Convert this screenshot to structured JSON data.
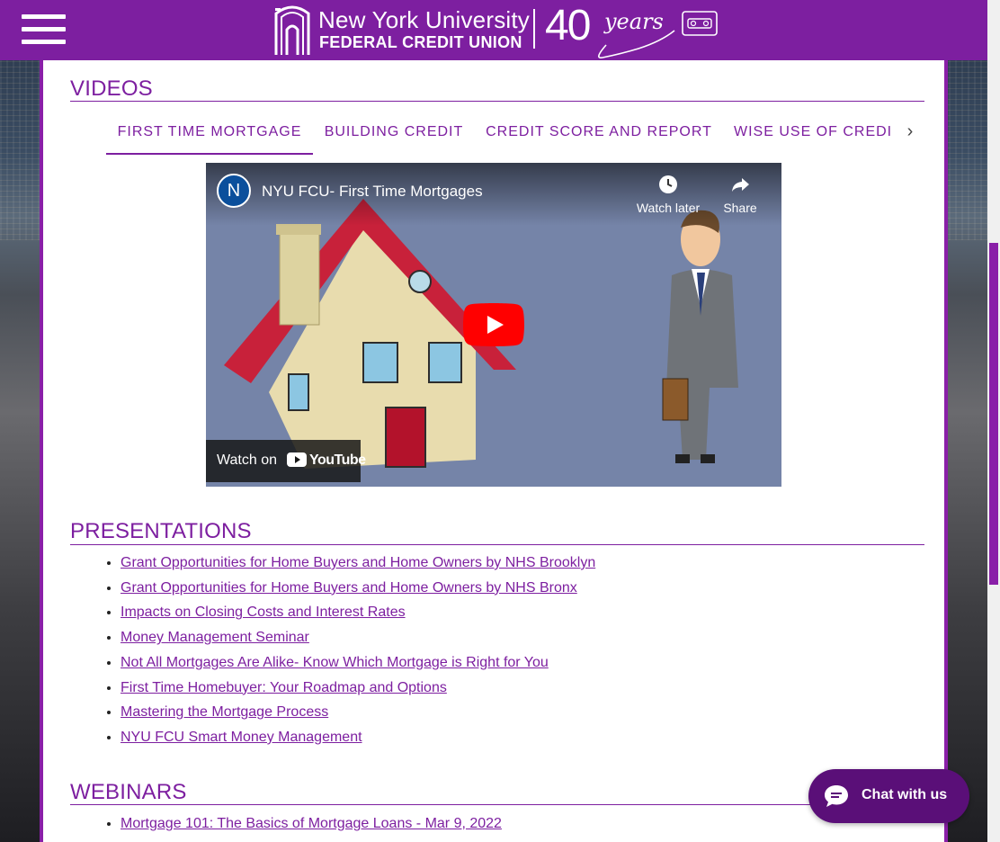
{
  "header": {
    "menu_label": "",
    "logo_title": "New York University",
    "logo_subtitle": "FEDERAL CREDIT UNION",
    "anniversary_number": "40",
    "anniversary_word": "years"
  },
  "sections": {
    "videos_title": "VIDEOS",
    "presentations_title": "PRESENTATIONS",
    "webinars_title": "WEBINARS"
  },
  "tabs": [
    {
      "label": "FIRST TIME MORTGAGE",
      "active": true
    },
    {
      "label": "BUILDING CREDIT",
      "active": false
    },
    {
      "label": "CREDIT SCORE AND REPORT",
      "active": false
    },
    {
      "label": "WISE USE OF CREDI",
      "active": false
    }
  ],
  "video": {
    "channel_initial": "N",
    "title": "NYU FCU- First Time Mortgages",
    "watch_later": "Watch later",
    "share": "Share",
    "watch_on": "Watch on",
    "youtube": "YouTube"
  },
  "presentations": [
    "Grant Opportunities for Home Buyers and Home Owners by NHS Brooklyn",
    "Grant Opportunities for Home Buyers and Home Owners by NHS Bronx",
    "Impacts on Closing Costs and Interest Rates",
    "Money Management Seminar",
    "Not All Mortgages Are Alike- Know Which Mortgage is Right for You",
    "First Time Homebuyer: Your Roadmap and Options",
    "Mastering the Mortgage Process",
    "NYU FCU Smart Money Management"
  ],
  "webinars": [
    "Mortgage 101: The Basics of Mortgage Loans - Mar 9, 2022"
  ],
  "chat": {
    "label": "Chat with us"
  },
  "colors": {
    "brand_purple": "#7d1fa0",
    "chat_purple": "#5a0f78"
  }
}
